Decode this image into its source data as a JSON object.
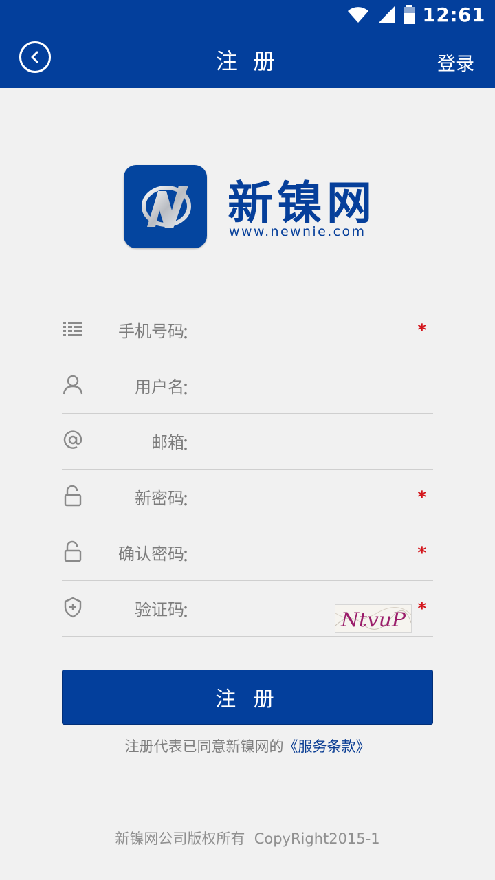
{
  "status_bar": {
    "time": "12:61"
  },
  "header": {
    "title": "注 册",
    "login_label": "登录"
  },
  "brand": {
    "name": "新镍网",
    "url": "www.newnie.com"
  },
  "form": {
    "fields": [
      {
        "label": "手机号码",
        "icon": "keypad-icon",
        "required": true,
        "required_mark": "*"
      },
      {
        "label": "用户名",
        "icon": "user-icon",
        "required": false
      },
      {
        "label": "邮箱",
        "icon": "at-icon",
        "required": false
      },
      {
        "label": "新密码",
        "icon": "lock-icon",
        "required": true,
        "required_mark": "*"
      },
      {
        "label": "确认密码",
        "icon": "lock-icon",
        "required": true,
        "required_mark": "*"
      },
      {
        "label": "验证码",
        "icon": "shield-plus-icon",
        "required": true,
        "required_mark": "*"
      }
    ],
    "colon": "：",
    "captcha_text": "NtvuP"
  },
  "submit": {
    "label": "注 册"
  },
  "agreement": {
    "prefix": "注册代表已同意新镍网的",
    "terms": "《服务条款》"
  },
  "footer": {
    "copyright": "新镍网公司版权所有  CopyRight2015-1"
  },
  "colors": {
    "primary": "#033f9c",
    "required": "#d3151b",
    "background": "#f1f1f1"
  }
}
